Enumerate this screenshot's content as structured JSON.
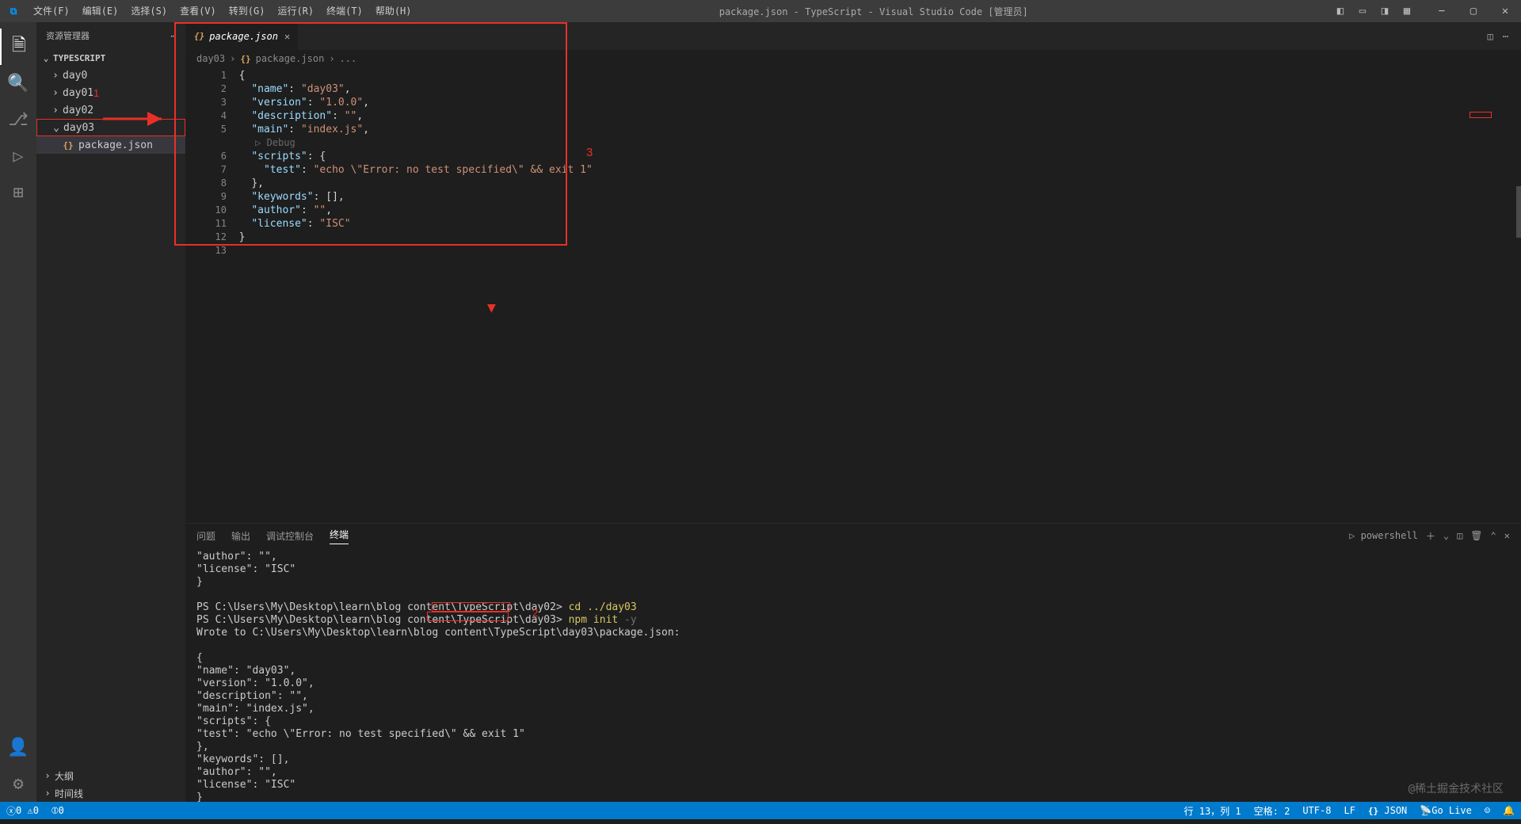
{
  "window_title": "package.json - TypeScript - Visual Studio Code [管理员]",
  "menu": [
    "文件(F)",
    "编辑(E)",
    "选择(S)",
    "查看(V)",
    "转到(G)",
    "运行(R)",
    "终端(T)",
    "帮助(H)"
  ],
  "sidebar": {
    "header": "资源管理器",
    "section": "TYPESCRIPT",
    "tree": [
      {
        "label": "day0",
        "expanded": false,
        "file": false
      },
      {
        "label": "day01",
        "expanded": false,
        "file": false,
        "badge": "1"
      },
      {
        "label": "day02",
        "expanded": false,
        "file": false
      },
      {
        "label": "day03",
        "expanded": true,
        "file": false,
        "highlight": true,
        "children": [
          {
            "label": "package.json",
            "file": true,
            "selected": true
          }
        ]
      }
    ],
    "outline": "大纲",
    "timeline": "时间线"
  },
  "tab": {
    "name": "package.json"
  },
  "breadcrumbs": [
    "day03",
    "package.json",
    "..."
  ],
  "editor": {
    "inlay": "Debug",
    "lines": [
      "{",
      "  \"name\": \"day03\",",
      "  \"version\": \"1.0.0\",",
      "  \"description\": \"\",",
      "  \"main\": \"index.js\",",
      "  \"scripts\": {",
      "    \"test\": \"echo \\\"Error: no test specified\\\" && exit 1\"",
      "  },",
      "  \"keywords\": [],",
      "  \"author\": \"\",",
      "  \"license\": \"ISC\"",
      "}",
      ""
    ]
  },
  "annotations": {
    "a1": "1",
    "a2": "2",
    "a3": "3"
  },
  "panel": {
    "tabs": [
      "问题",
      "输出",
      "调试控制台",
      "终端"
    ],
    "active_tab": "终端",
    "shell_label": "powershell",
    "prompt_path1": "PS C:\\Users\\My\\Desktop\\learn\\blog content\\TypeScript\\day02> ",
    "prompt_path2": "PS C:\\Users\\My\\Desktop\\learn\\blog content\\TypeScript\\day03> ",
    "cmd1": "cd ../day03",
    "cmd2": "npm init",
    "cmd2_flag": " -y",
    "wrote": "Wrote to C:\\Users\\My\\Desktop\\learn\\blog content\\TypeScript\\day03\\package.json:",
    "json_out": [
      "{",
      "  \"name\": \"day03\",",
      "  \"version\": \"1.0.0\",",
      "  \"description\": \"\",",
      "  \"main\": \"index.js\",",
      "  \"scripts\": {",
      "    \"test\": \"echo \\\"Error: no test specified\\\" && exit 1\"",
      "  },",
      "  \"keywords\": [],",
      "  \"author\": \"\",",
      "  \"license\": \"ISC\"",
      "}"
    ],
    "tail": [
      "  \"author\": \"\",",
      "  \"license\": \"ISC\"",
      "}",
      ""
    ],
    "watermark": "@稀土掘金技术社区"
  },
  "status": {
    "left_errors": "0",
    "left_warnings": "0",
    "pos": "行 13，列 1",
    "spaces": "空格: 2",
    "encoding": "UTF-8",
    "eol": "LF",
    "lang": "JSON",
    "golive": "Go Live",
    "port": "0"
  }
}
